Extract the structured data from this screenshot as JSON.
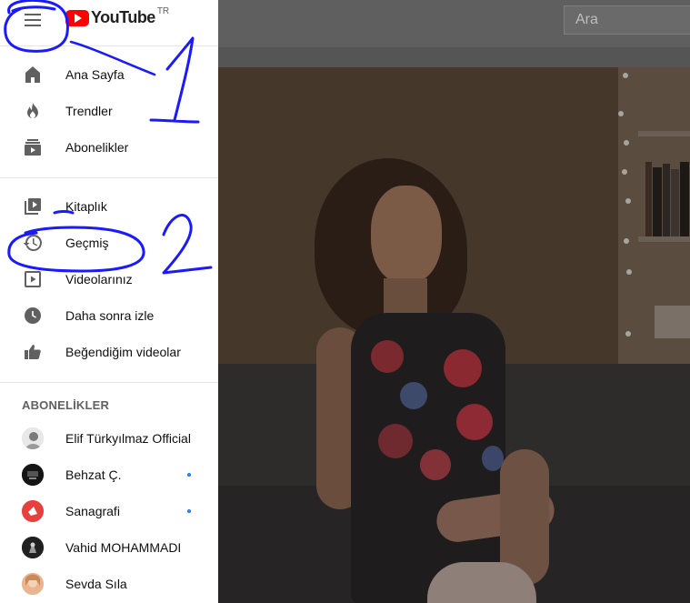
{
  "masthead": {
    "logo_text": "YouTube",
    "region": "TR",
    "search_placeholder": "Ara"
  },
  "guide": {
    "section1": [
      {
        "label": "Ana Sayfa",
        "icon": "home-icon"
      },
      {
        "label": "Trendler",
        "icon": "trending-icon"
      },
      {
        "label": "Abonelikler",
        "icon": "subscriptions-icon"
      }
    ],
    "section2": [
      {
        "label": "Kitaplık",
        "icon": "library-icon"
      },
      {
        "label": "Geçmiş",
        "icon": "history-icon"
      },
      {
        "label": "Videolarınız",
        "icon": "your-videos-icon"
      },
      {
        "label": "Daha sonra izle",
        "icon": "watch-later-icon"
      },
      {
        "label": "Beğendiğim videolar",
        "icon": "liked-videos-icon"
      }
    ],
    "subscriptions_heading": "ABONELİKLER",
    "subscriptions": [
      {
        "label": "Elif Türkyılmaz Official",
        "new_content": false
      },
      {
        "label": "Behzat Ç.",
        "new_content": true
      },
      {
        "label": "Sanagrafi",
        "new_content": true
      },
      {
        "label": "Vahid MOHAMMADI",
        "new_content": false
      },
      {
        "label": "Sevda Sıla",
        "new_content": false
      }
    ]
  },
  "annotations": {
    "mark1": "1",
    "mark2": "2"
  },
  "colors": {
    "brand_red": "#ff0000",
    "annotation_blue": "#1a1aff",
    "new_dot_blue": "#2979ff"
  }
}
